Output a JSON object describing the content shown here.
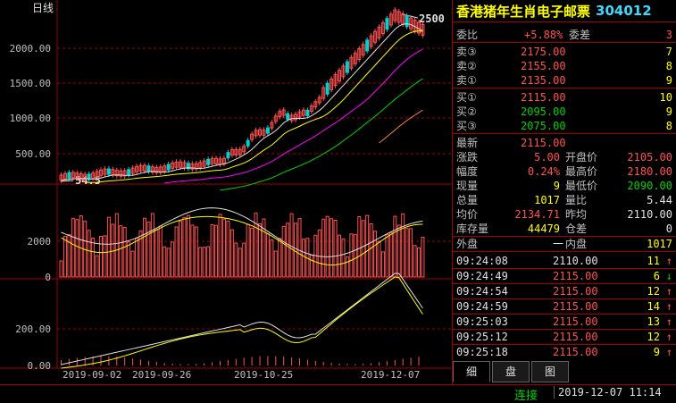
{
  "chart": {
    "period_label": "日线",
    "high_label": "2500",
    "low_label": "54.5",
    "price_axis": [
      "2000.00",
      "1500.00",
      "1000.00",
      "500.00"
    ],
    "vol_axis": [
      "2000",
      "0"
    ],
    "macd_axis": [
      "200.00",
      "0.00"
    ],
    "date_labels": [
      "2019-09-02",
      "2019-09-26",
      "2019-10-25",
      "2019-12-07"
    ]
  },
  "quote": {
    "name": "香港猪年生肖电子邮票",
    "code": "304012",
    "weibi_label": "委比",
    "weibi_value": "+5.88%",
    "weicha_label": "委差",
    "weicha_value": "3",
    "sell": [
      {
        "label": "卖③",
        "price": "2175.00",
        "qty": "7"
      },
      {
        "label": "卖②",
        "price": "2155.00",
        "qty": "8"
      },
      {
        "label": "卖①",
        "price": "2135.00",
        "qty": "9"
      }
    ],
    "buy": [
      {
        "label": "买①",
        "price": "2115.00",
        "qty": "10"
      },
      {
        "label": "买②",
        "price": "2095.00",
        "qty": "9"
      },
      {
        "label": "买③",
        "price": "2075.00",
        "qty": "8"
      }
    ],
    "latest_label": "最新",
    "latest_value": "2115.00",
    "change_label": "涨跌",
    "change_value": "5.00",
    "open_label": "开盘价",
    "open_value": "2105.00",
    "pct_label": "幅度",
    "pct_value": "0.24%",
    "high_label": "最高价",
    "high_value": "2180.00",
    "vol_label": "现量",
    "vol_value": "9",
    "low_label": "最低价",
    "low_value": "2090.00",
    "total_label": "总量",
    "total_value": "1017",
    "ratio_label": "量比",
    "ratio_value": "5.44",
    "avg_label": "均价",
    "avg_value": "2134.71",
    "prev_label": "昨均",
    "prev_value": "2110.00",
    "stock_label": "库存量",
    "stock_value": "44479",
    "cang_label": "仓差",
    "cang_value": "0",
    "outer_label": "外盘",
    "outer_value": "一",
    "inner_label": "内盘",
    "inner_value": "1017"
  },
  "ticks": [
    {
      "time": "09:24:08",
      "price": "2110.00",
      "qty": "11",
      "dir": "↑"
    },
    {
      "time": "09:24:49",
      "price": "2115.00",
      "qty": "6",
      "dir": "↓"
    },
    {
      "time": "09:24:54",
      "price": "2115.00",
      "qty": "12",
      "dir": "↑"
    },
    {
      "time": "09:24:59",
      "price": "2115.00",
      "qty": "14",
      "dir": "↑"
    },
    {
      "time": "09:25:03",
      "price": "2115.00",
      "qty": "13",
      "dir": "↑"
    },
    {
      "time": "09:25:12",
      "price": "2115.00",
      "qty": "12",
      "dir": "↑"
    },
    {
      "time": "09:25:18",
      "price": "2115.00",
      "qty": "9",
      "dir": "↑"
    }
  ],
  "tabs": [
    "细",
    "盘",
    "图"
  ],
  "status": {
    "connection": "连接",
    "datetime": "2019-12-07  11:14"
  },
  "colors": {
    "up": "#ff5050",
    "down": "#00d000",
    "grid": "#a00000",
    "label": "#ffff00"
  }
}
